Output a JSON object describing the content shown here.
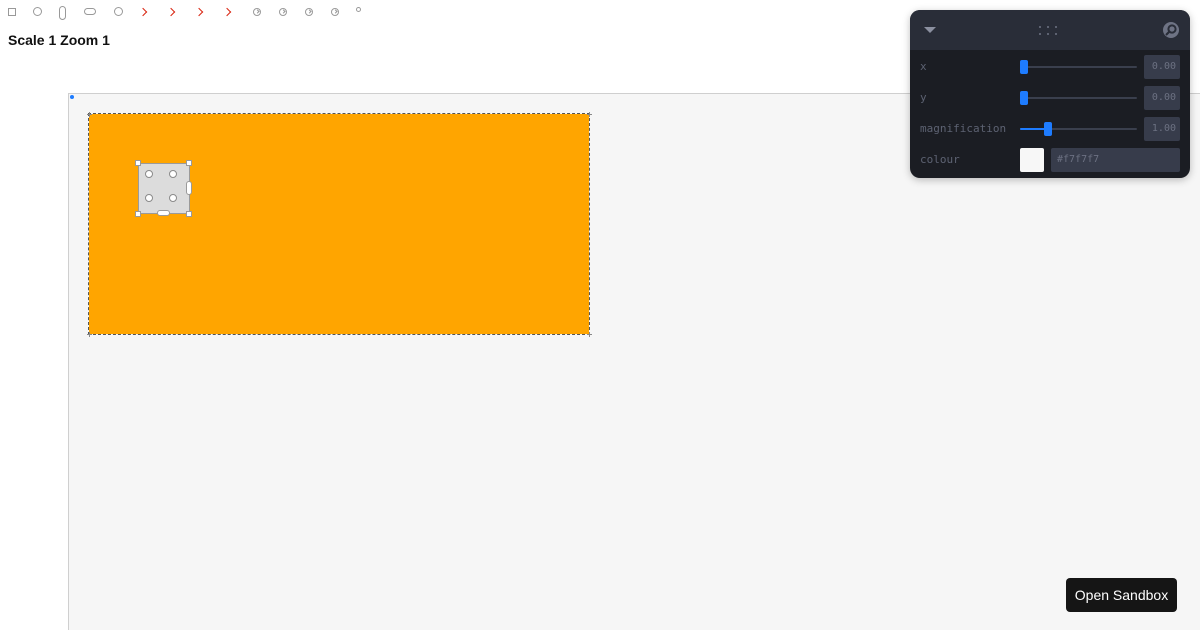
{
  "toolbar": {
    "tools": [
      {
        "name": "square-tool-icon"
      },
      {
        "name": "circle-tool-icon"
      },
      {
        "name": "vertical-pill-tool-icon"
      },
      {
        "name": "horizontal-pill-tool-icon"
      },
      {
        "name": "circle-outline-tool-icon"
      },
      {
        "name": "chevron-right-icon"
      },
      {
        "name": "chevron-right-icon"
      },
      {
        "name": "chevron-right-icon"
      },
      {
        "name": "chevron-right-icon"
      },
      {
        "name": "circle-arrow-icon"
      },
      {
        "name": "circle-arrow-icon"
      },
      {
        "name": "circle-arrow-icon"
      },
      {
        "name": "circle-arrow-icon"
      },
      {
        "name": "small-dot-icon"
      }
    ]
  },
  "header": {
    "title": "Scale 1 Zoom 1"
  },
  "canvas": {
    "frame_color": "#ffa500",
    "background_color": "#f6f6f6"
  },
  "controls": {
    "rows": [
      {
        "label": "x",
        "value": "0.00",
        "fraction": 0.0
      },
      {
        "label": "y",
        "value": "0.00",
        "fraction": 0.0
      },
      {
        "label": "magnification",
        "value": "1.00",
        "fraction": 0.22
      }
    ],
    "colour": {
      "label": "colour",
      "value": "#f7f7f7"
    },
    "accent": "#1e7cff"
  },
  "actions": {
    "open_sandbox_label": "Open Sandbox"
  }
}
